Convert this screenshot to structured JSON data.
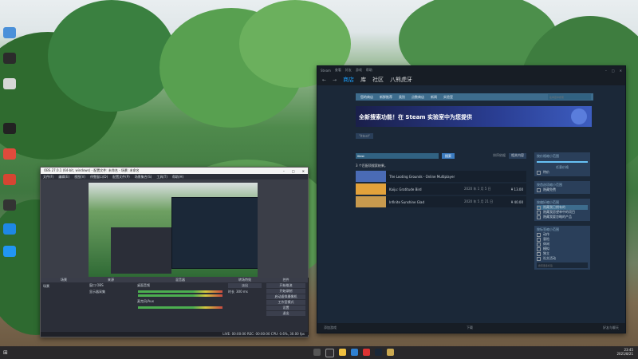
{
  "obs": {
    "title": "OBS 27.0.1 (64-bit, windows) - 配置文件: 未命名 - 场景: 未命名",
    "menu": [
      "文件(F)",
      "编辑(E)",
      "视图(V)",
      "停靠窗口(D)",
      "配置文件(P)",
      "场景集合(S)",
      "工具(T)",
      "帮助(H)"
    ],
    "docks": {
      "scenes": {
        "title": "场景",
        "items": [
          "场景"
        ]
      },
      "sources": {
        "title": "来源",
        "items": [
          "窗口 OBS",
          "显示器采集"
        ]
      },
      "mixer": {
        "title": "混音器",
        "tracks": [
          "桌面音频",
          "麦克风/Aux"
        ]
      },
      "transitions": {
        "title": "转场特效",
        "type": "淡出",
        "duration_label": "时长",
        "duration_value": "300 ms"
      },
      "controls": {
        "title": "控件",
        "buttons": [
          "开始推流",
          "开始录制",
          "启动虚拟摄像机",
          "工作室模式",
          "设置",
          "退出"
        ]
      }
    },
    "status": "LIVE: 00:00:00   REC: 00:00:00   CPU: 0.6%, 30.00 fps"
  },
  "steam": {
    "topbar": {
      "menus": [
        "Steam",
        "查看",
        "好友",
        "游戏",
        "帮助"
      ]
    },
    "nav": {
      "tabs": [
        "商店",
        "库",
        "社区",
        "八熊虎牙"
      ]
    },
    "store_nav": [
      "您的商店",
      "新鲜推荐",
      "类别",
      "点数商店",
      "新闻",
      "实验室"
    ],
    "search_placeholder": "在商店中搜索",
    "banner_text": "全新搜索功能！在 Steam 实验室中为您提供",
    "filter_tag": "\"Ittest\"",
    "search": {
      "value": "Ittest",
      "button": "搜索",
      "sort_label": "排序依据",
      "sort_value": "相关内容"
    },
    "results_count": "3 个匹配项搜索结果。",
    "results": [
      {
        "name": "The Looting Grounds - Online Multiplayer",
        "date": "",
        "price": ""
      },
      {
        "name": "Kaiju: Gratitude Bird",
        "date": "2020 年 1 月 5 日",
        "price": "¥ 13.00"
      },
      {
        "name": "Infinite Sunshine Glad",
        "date": "2020 年 5 月 21 日",
        "price": "¥ 40.00"
      }
    ],
    "sidebar": {
      "price": {
        "title": "按价格缩小范围",
        "value": "任意价格",
        "rows": [
          "特价"
        ]
      },
      "preferences": {
        "title": "按首选项缩小范围",
        "rows": [
          "隐藏免费"
        ]
      },
      "library": {
        "title": "按偏好缩小范围",
        "rows": [
          "隐藏我已拥有的",
          "隐藏我愿望单中的项目",
          "隐藏我要忽略的产品"
        ]
      },
      "tags": {
        "title": "按标签缩小范围",
        "rows": [
          "动作",
          "冒险",
          "休闲",
          "模拟",
          "独立",
          "社交活动"
        ],
        "search_placeholder": "搜索更多标签"
      }
    },
    "bottom": {
      "left": "添加游戏",
      "center": "下载",
      "right": "好友与聊天"
    }
  },
  "taskbar": {
    "time": "23:45",
    "date": "2021/8/21"
  }
}
